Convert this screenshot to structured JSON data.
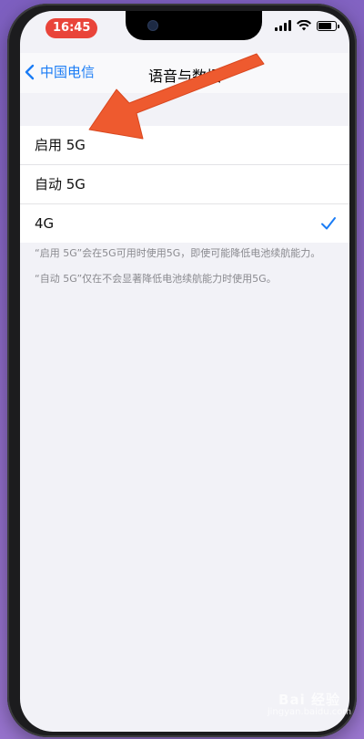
{
  "status": {
    "time": "16:45",
    "battery_level": 0.9
  },
  "navbar": {
    "back_label": "中国电信",
    "title": "语音与数据"
  },
  "options": [
    {
      "label": "启用 5G",
      "selected": false
    },
    {
      "label": "自动 5G",
      "selected": false
    },
    {
      "label": "4G",
      "selected": true
    }
  ],
  "footer": {
    "note1": "“启用 5G”会在5G可用时使用5G，即使可能降低电池续航能力。",
    "note2": "“自动 5G”仅在不会显著降低电池续航能力时使用5G。"
  },
  "watermark": {
    "brand": "Bai 经验",
    "site": "jingyan.baidu.com"
  },
  "colors": {
    "accent": "#1a7cf5",
    "arrow": "#ee5a2f",
    "time_badge": "#e9443a"
  },
  "icons": {
    "back": "chevron-left-icon",
    "check": "checkmark-icon",
    "wifi": "wifi-icon",
    "signal": "signal-icon",
    "battery": "battery-icon"
  }
}
